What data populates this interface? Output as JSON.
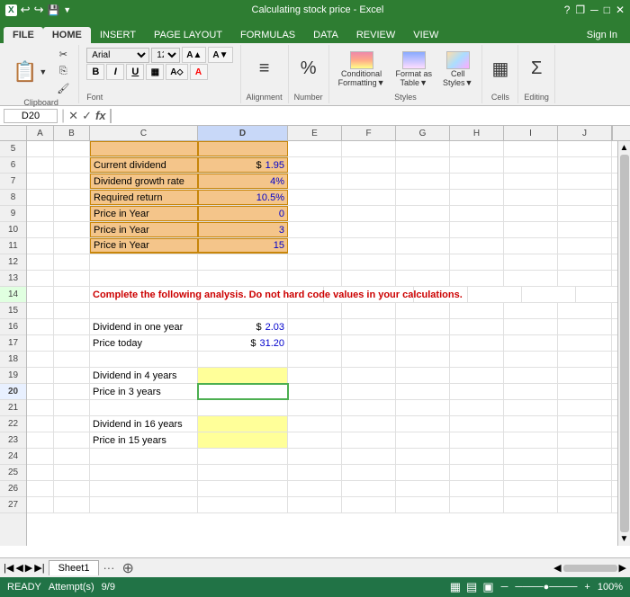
{
  "window": {
    "title": "Calculating stock price - Excel",
    "title_prefix": "Calculating stock",
    "help_icon": "?",
    "restore_icon": "❐",
    "minimize_icon": "─",
    "maximize_icon": "□",
    "close_icon": "✕"
  },
  "ribbon": {
    "tabs": [
      "FILE",
      "HOME",
      "INSERT",
      "PAGE LAYOUT",
      "FORMULAS",
      "DATA",
      "REVIEW",
      "VIEW"
    ],
    "active_tab": "HOME",
    "sign_in": "Sign In",
    "groups": {
      "clipboard": "Clipboard",
      "font": "Font",
      "alignment": "Alignment",
      "number": "Number",
      "styles": "Styles",
      "cells": "Cells",
      "editing": "Editing"
    },
    "font_name": "Arial",
    "font_size": "12"
  },
  "formula_bar": {
    "cell_ref": "D20",
    "formula": ""
  },
  "columns": [
    "A",
    "B",
    "C",
    "D",
    "E",
    "F",
    "G",
    "H",
    "I",
    "J"
  ],
  "rows": [
    5,
    6,
    7,
    8,
    9,
    10,
    11,
    12,
    13,
    14,
    15,
    16,
    17,
    18,
    19,
    20,
    21,
    22,
    23,
    24,
    25,
    26,
    27
  ],
  "cells": {
    "C6": "Current dividend",
    "D6_prefix": "$",
    "D6_val": "1.95",
    "C7": "Dividend growth rate",
    "D7": "4%",
    "C8": "Required return",
    "D8": "10.5%",
    "C9": "Price in Year",
    "D9": "0",
    "C10": "Price in Year",
    "D10": "3",
    "C11": "Price in Year",
    "D11": "15",
    "C14": "Complete the following analysis. Do not hard code values in your calculations.",
    "C16": "Dividend in one year",
    "D16_prefix": "$",
    "D16_val": "2.03",
    "C17": "Price today",
    "D17_prefix": "$",
    "D17_val": "31.20",
    "C19": "Dividend in 4 years",
    "C20": "Price in 3 years",
    "C22": "Dividend in 16 years",
    "C23": "Price in 15 years"
  },
  "status_bar": {
    "ready": "READY",
    "attempts": "Attempt(s)",
    "attempts_value": "9/9",
    "zoom": "100%"
  },
  "tabs": [
    "Sheet1"
  ],
  "colors": {
    "orange_bg": "#f4c28a",
    "yellow_bg": "#ffff99",
    "red_text": "#cc0000",
    "blue_text": "#0000cc",
    "green_accent": "#217346",
    "selected_cell_border": "#4caf50"
  }
}
